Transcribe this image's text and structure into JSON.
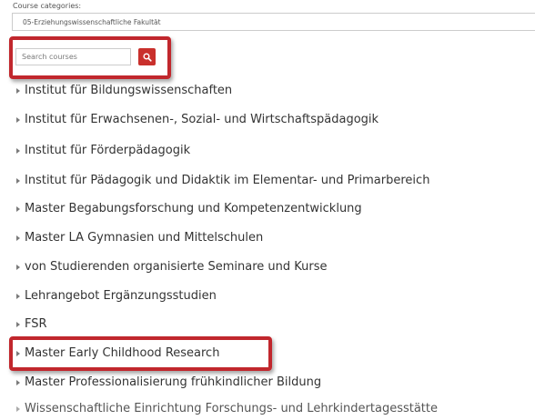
{
  "category_filter": {
    "label": "Course categories:",
    "selected": "05-Erziehungswissenschaftliche Fakultät"
  },
  "search": {
    "placeholder": "Search courses",
    "button_icon": "search-icon"
  },
  "categories": [
    {
      "label": "Institut für Bildungswissenschaften"
    },
    {
      "label": "Institut für Erwachsenen-, Sozial- und Wirtschaftspädagogik"
    },
    {
      "label": "Institut für Förderpädagogik"
    },
    {
      "label": "Institut für Pädagogik und Didaktik im Elementar- und Primarbereich"
    },
    {
      "label": "Master Begabungsforschung und Kompetenzentwicklung"
    },
    {
      "label": "Master LA Gymnasien und Mittelschulen"
    },
    {
      "label": "von Studierenden organisierte Seminare und Kurse"
    },
    {
      "label": "Lehrangebot Ergänzungsstudien"
    },
    {
      "label": "FSR"
    },
    {
      "label": "Master Early Childhood Research"
    },
    {
      "label": "Master Professionalisierung frühkindlicher Bildung"
    },
    {
      "label": "Wissenschaftliche Einrichtung Forschungs- und Lehrkindertagesstätte"
    }
  ],
  "colors": {
    "highlight": "#c1272d",
    "search_button": "#c9302c"
  }
}
